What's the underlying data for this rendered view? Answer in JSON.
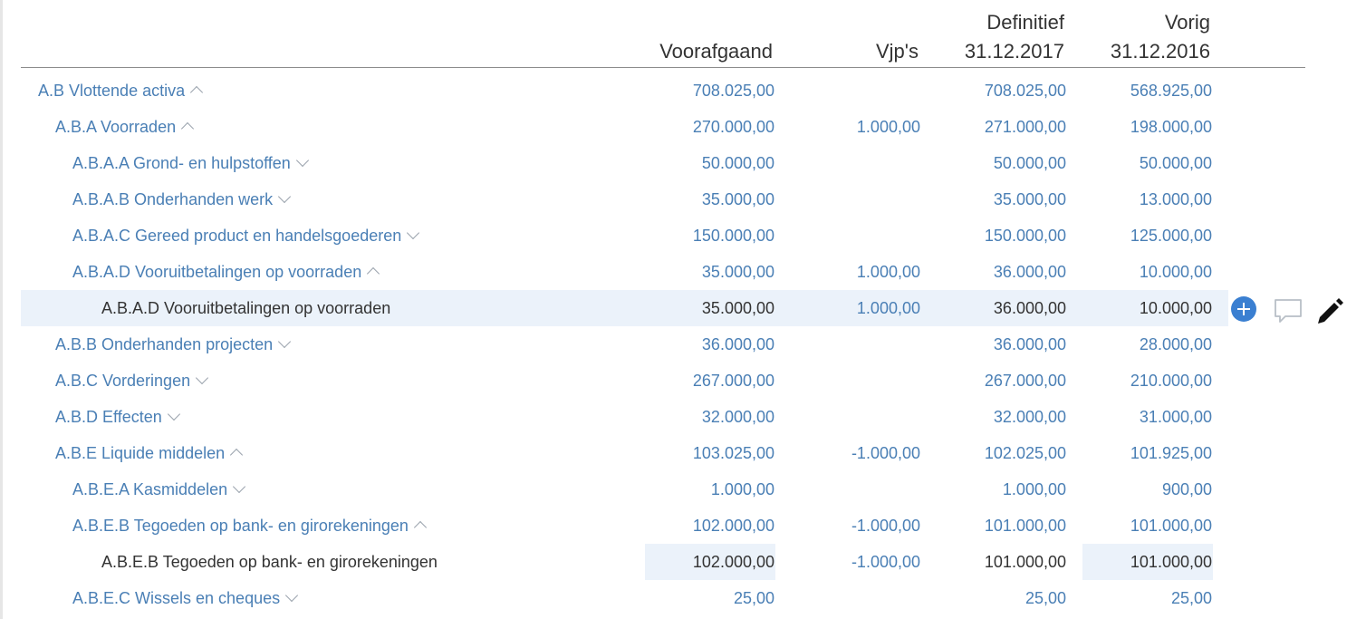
{
  "columns": {
    "prev": {
      "line1": "",
      "line2": "Voorafgaand"
    },
    "vjp": {
      "line1": "",
      "line2": "Vjp's"
    },
    "definitief": {
      "line1": "Definitief",
      "line2": "31.12.2017"
    },
    "vorig": {
      "line1": "Vorig",
      "line2": "31.12.2016"
    }
  },
  "rows": [
    {
      "label": "A.B Vlottende activa",
      "chevron": "up",
      "prev": "708.025,00",
      "vjp": "",
      "def": "708.025,00",
      "vorig": "568.925,00"
    },
    {
      "label": "A.B.A Voorraden",
      "chevron": "up",
      "prev": "270.000,00",
      "vjp": "1.000,00",
      "def": "271.000,00",
      "vorig": "198.000,00"
    },
    {
      "label": "A.B.A.A Grond- en hulpstoffen",
      "chevron": "down",
      "prev": "50.000,00",
      "vjp": "",
      "def": "50.000,00",
      "vorig": "50.000,00"
    },
    {
      "label": "A.B.A.B Onderhanden werk",
      "chevron": "down",
      "prev": "35.000,00",
      "vjp": "",
      "def": "35.000,00",
      "vorig": "13.000,00"
    },
    {
      "label": "A.B.A.C Gereed product en handelsgoederen",
      "chevron": "down",
      "prev": "150.000,00",
      "vjp": "",
      "def": "150.000,00",
      "vorig": "125.000,00"
    },
    {
      "label": "A.B.A.D Vooruitbetalingen op voorraden",
      "chevron": "up",
      "prev": "35.000,00",
      "vjp": "1.000,00",
      "def": "36.000,00",
      "vorig": "10.000,00"
    },
    {
      "label": "A.B.A.D Vooruitbetalingen op voorraden",
      "chevron": "",
      "prev": "35.000,00",
      "vjp": "1.000,00",
      "def": "36.000,00",
      "vorig": "10.000,00"
    },
    {
      "label": "A.B.B Onderhanden projecten",
      "chevron": "down",
      "prev": "36.000,00",
      "vjp": "",
      "def": "36.000,00",
      "vorig": "28.000,00"
    },
    {
      "label": "A.B.C Vorderingen",
      "chevron": "down",
      "prev": "267.000,00",
      "vjp": "",
      "def": "267.000,00",
      "vorig": "210.000,00"
    },
    {
      "label": "A.B.D Effecten",
      "chevron": "down",
      "prev": "32.000,00",
      "vjp": "",
      "def": "32.000,00",
      "vorig": "31.000,00"
    },
    {
      "label": "A.B.E Liquide middelen",
      "chevron": "up",
      "prev": "103.025,00",
      "vjp": "-1.000,00",
      "def": "102.025,00",
      "vorig": "101.925,00"
    },
    {
      "label": "A.B.E.A Kasmiddelen",
      "chevron": "down",
      "prev": "1.000,00",
      "vjp": "",
      "def": "1.000,00",
      "vorig": "900,00"
    },
    {
      "label": "A.B.E.B Tegoeden op bank- en girorekeningen",
      "chevron": "up",
      "prev": "102.000,00",
      "vjp": "-1.000,00",
      "def": "101.000,00",
      "vorig": "101.000,00"
    },
    {
      "label": "A.B.E.B Tegoeden op bank- en girorekeningen",
      "chevron": "",
      "prev": "102.000,00",
      "vjp": "-1.000,00",
      "def": "101.000,00",
      "vorig": "101.000,00"
    },
    {
      "label": "A.B.E.C Wissels en cheques",
      "chevron": "down",
      "prev": "25,00",
      "vjp": "",
      "def": "25,00",
      "vorig": "25,00"
    }
  ],
  "icons": {
    "add": "plus-circle-icon",
    "comment": "comment-bubble-icon",
    "edit": "pencil-icon"
  },
  "colors": {
    "link": "#4a7fb5",
    "text": "#333333",
    "highlight": "#ebf2fa",
    "accent": "#3a7fd1"
  }
}
